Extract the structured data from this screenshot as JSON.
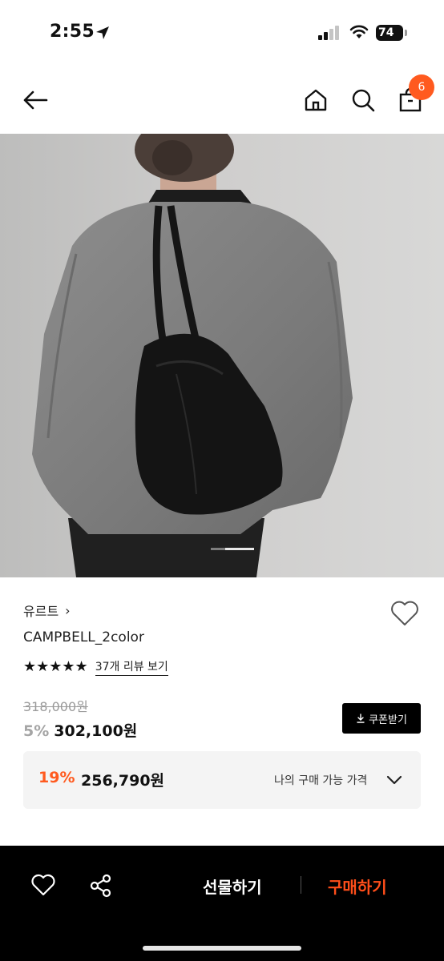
{
  "status_bar": {
    "time": "2:55",
    "battery": "74"
  },
  "nav": {
    "cart_count": "6"
  },
  "gallery": {
    "slide_position": 1,
    "slide_count": 3
  },
  "product": {
    "brand": "유르트",
    "brand_chevron": "›",
    "name": "CAMPBELL_2color",
    "stars": "★★★★★",
    "rating": 5,
    "review_link": "37개 리뷰 보기",
    "original_price": "318,000원",
    "sale_rate": "5%",
    "sale_price": "302,100원",
    "coupon_label": "쿠폰받기",
    "my_rate": "19%",
    "my_price": "256,790원",
    "my_price_label": "나의 구매 가능 가격"
  },
  "bottom_bar": {
    "gift_label": "선물하기",
    "buy_label": "구매하기"
  },
  "colors": {
    "accent": "#ff5a1f",
    "buy": "#ff4e1a",
    "bar": "#000000"
  },
  "icons": [
    "location-arrow-icon",
    "signal-icon",
    "wifi-icon",
    "back-arrow-icon",
    "home-icon",
    "search-icon",
    "bag-icon",
    "heart-outline-icon",
    "download-icon",
    "chevron-down-icon",
    "share-icon"
  ]
}
